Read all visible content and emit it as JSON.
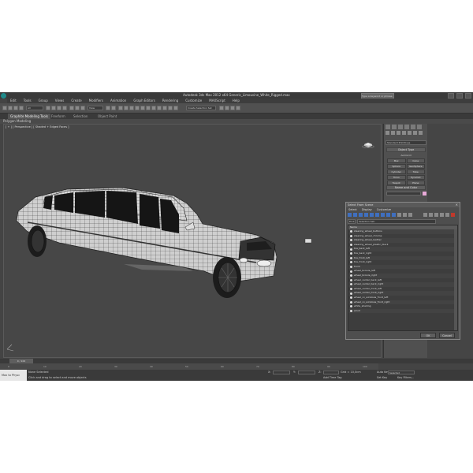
{
  "window": {
    "title": "Autodesk 3ds Max 2012 x64    Generic_Limousine_White_Rigged.max",
    "search_placeholder": "Type a keyword or phrase"
  },
  "menu": [
    "Edit",
    "Tools",
    "Group",
    "Views",
    "Create",
    "Modifiers",
    "Animation",
    "Graph Editors",
    "Rendering",
    "Customize",
    "MAXScript",
    "Help"
  ],
  "toolbar": {
    "filter_value": "All",
    "view_value": "View",
    "selection_set": "Create Selection Set"
  },
  "ribbon": {
    "tabs": [
      "Graphite Modeling Tools",
      "Freeform",
      "Selection",
      "Object Paint"
    ],
    "subtitle": "Polygon Modeling"
  },
  "viewport": {
    "label": "[ + ] [ Perspective ] [ Shaded + Edged Faces ]"
  },
  "command_panel": {
    "object_dropdown": "Standard Primitives",
    "object_type_header": "Object Type",
    "autogrid_label": "AutoGrid",
    "buttons": [
      "Box",
      "Cone",
      "Sphere",
      "GeoSphere",
      "Cylinder",
      "Tube",
      "Torus",
      "Pyramid",
      "Teapot",
      "Plane"
    ],
    "name_color_header": "Name and Color"
  },
  "dialog": {
    "title": "Select From Scene",
    "menu": [
      "Select",
      "Display",
      "Customize"
    ],
    "find_label": "Find:",
    "selection_set_label": "Selection Set:",
    "column_header": "Name",
    "items": [
      "steering_wheel_buttons",
      "steering_wheel_chrome",
      "steering_wheel_leather",
      "steering_wheel_plastic_black",
      "tire_back_left",
      "tire_back_right",
      "tire_front_left",
      "tire_front_right",
      "trunk",
      "wheel_bronze_left",
      "wheel_bronze_right",
      "wheel_center_back_left",
      "wheel_center_back_right",
      "wheel_center_front_left",
      "wheel_center_front_right",
      "wheel_cv_windows_front_left",
      "wheel_cv_windows_front_right",
      "white_shading",
      "wood"
    ],
    "ok_label": "OK",
    "cancel_label": "Cancel"
  },
  "timeline": {
    "slider_label": "0 / 100",
    "ticks": [
      "0",
      "10",
      "20",
      "30",
      "40",
      "50",
      "60",
      "70",
      "80",
      "90",
      "100"
    ]
  },
  "status": {
    "maxscript_label": "Max to Physc",
    "selection_status": "None Selected",
    "prompt": "Click and drag to select and move objects",
    "x_label": "X:",
    "y_label": "Y:",
    "z_label": "Z:",
    "grid_label": "Grid = 10,0cm",
    "autokey_label": "Auto Key",
    "autokey_value": "Selected",
    "setkey_label": "Set Key",
    "keyfilters_label": "Key Filters...",
    "add_time_tag": "Add Time Tag"
  }
}
